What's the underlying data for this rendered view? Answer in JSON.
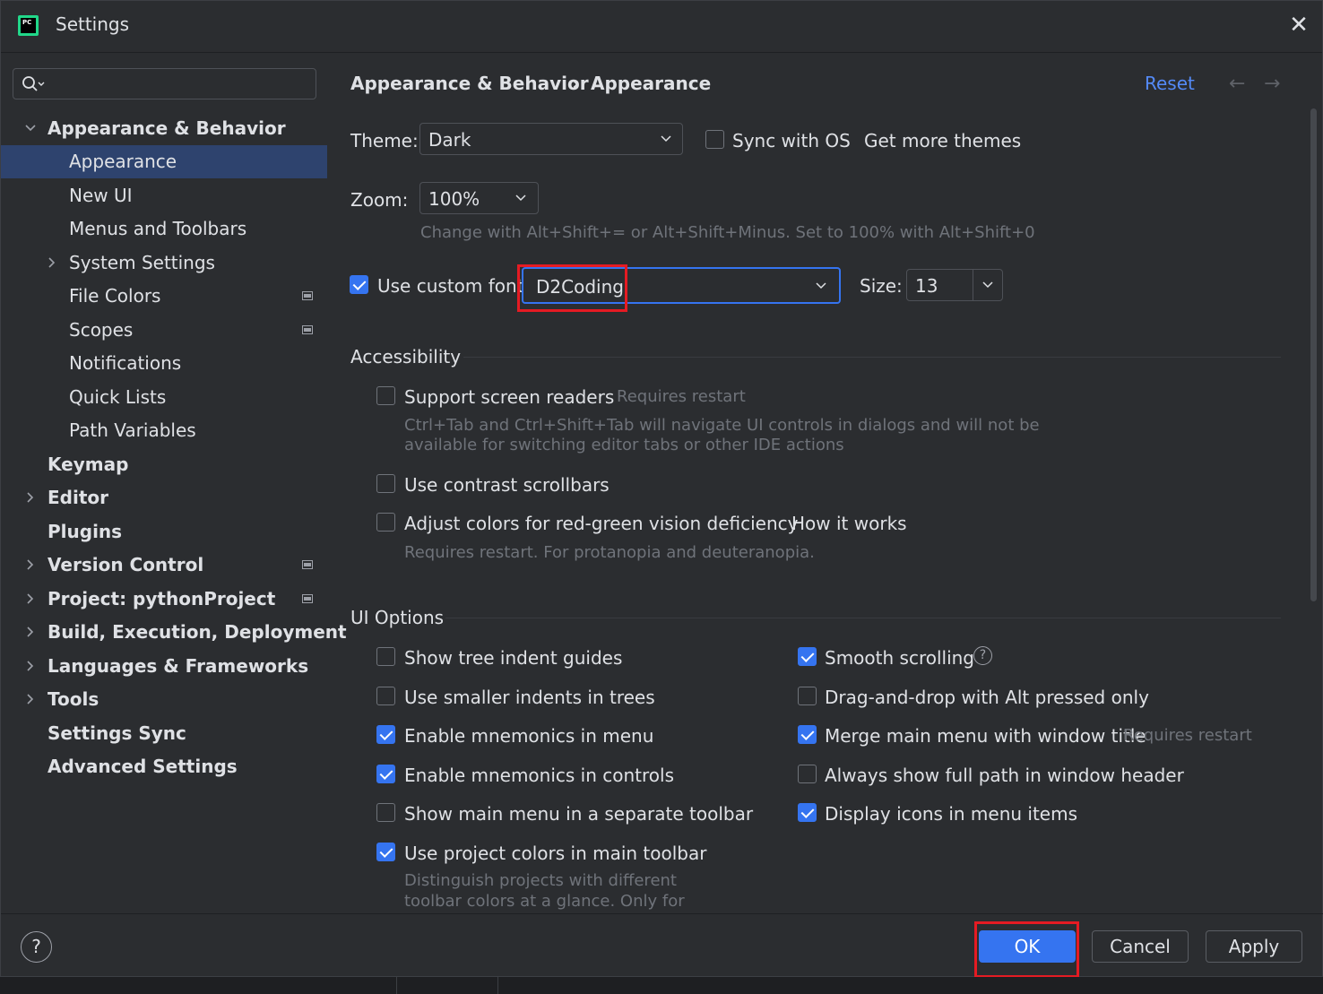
{
  "window": {
    "title": "Settings"
  },
  "sidebar": {
    "search_placeholder": "",
    "items": [
      {
        "label": "Appearance & Behavior"
      },
      {
        "label": "Appearance"
      },
      {
        "label": "New UI"
      },
      {
        "label": "Menus and Toolbars"
      },
      {
        "label": "System Settings"
      },
      {
        "label": "File Colors"
      },
      {
        "label": "Scopes"
      },
      {
        "label": "Notifications"
      },
      {
        "label": "Quick Lists"
      },
      {
        "label": "Path Variables"
      },
      {
        "label": "Keymap"
      },
      {
        "label": "Editor"
      },
      {
        "label": "Plugins"
      },
      {
        "label": "Version Control"
      },
      {
        "label": "Project: pythonProject"
      },
      {
        "label": "Build, Execution, Deployment"
      },
      {
        "label": "Languages & Frameworks"
      },
      {
        "label": "Tools"
      },
      {
        "label": "Settings Sync"
      },
      {
        "label": "Advanced Settings"
      }
    ]
  },
  "header": {
    "breadcrumb_parent": "Appearance & Behavior",
    "breadcrumb_sep": "›",
    "breadcrumb_current": "Appearance",
    "reset": "Reset",
    "back_arrow": "←",
    "forward_arrow": "→"
  },
  "appearance": {
    "theme_label": "Theme:",
    "theme_value": "Dark",
    "sync_os": "Sync with OS",
    "get_more_themes": "Get more themes",
    "zoom_label": "Zoom:",
    "zoom_value": "100%",
    "zoom_hint": "Change with Alt+Shift+= or Alt+Shift+Minus. Set to 100% with Alt+Shift+0",
    "custom_font_label": "Use custom font:",
    "custom_font_value": "D2Coding",
    "size_label": "Size:",
    "size_value": "13"
  },
  "accessibility": {
    "title": "Accessibility",
    "screen_readers": "Support screen readers",
    "screen_readers_note": "Requires restart",
    "screen_readers_hint_1": "Ctrl+Tab and Ctrl+Shift+Tab will navigate UI controls in dialogs and will not be",
    "screen_readers_hint_2": "available for switching editor tabs or other IDE actions",
    "contrast_scrollbars": "Use contrast scrollbars",
    "color_deficiency": "Adjust colors for red-green vision deficiency",
    "how_it_works": "How it works",
    "color_deficiency_hint": "Requires restart. For protanopia and deuteranopia."
  },
  "ui_options": {
    "title": "UI Options",
    "left": [
      {
        "label": "Show tree indent guides",
        "checked": false
      },
      {
        "label": "Use smaller indents in trees",
        "checked": false
      },
      {
        "label": "Enable mnemonics in menu",
        "checked": true
      },
      {
        "label": "Enable mnemonics in controls",
        "checked": true
      },
      {
        "label": "Show main menu in a separate toolbar",
        "checked": false
      },
      {
        "label": "Use project colors in main toolbar",
        "checked": true
      }
    ],
    "right": [
      {
        "label": "Smooth scrolling",
        "checked": true
      },
      {
        "label": "Drag-and-drop with Alt pressed only",
        "checked": false
      },
      {
        "label": "Merge main menu with window title",
        "checked": true
      },
      {
        "label": "Always show full path in window header",
        "checked": false
      },
      {
        "label": "Display icons in menu items",
        "checked": true
      }
    ],
    "merge_note": "Requires restart",
    "project_colors_hint_1": "Distinguish projects with different",
    "project_colors_hint_2": "toolbar colors at a glance. Only for"
  },
  "footer": {
    "help": "?",
    "ok": "OK",
    "cancel": "Cancel",
    "apply": "Apply"
  },
  "colors": {
    "accent": "#3574f0",
    "link": "#548af7",
    "selection": "#2e436e",
    "highlight_box": "#e51b23"
  }
}
